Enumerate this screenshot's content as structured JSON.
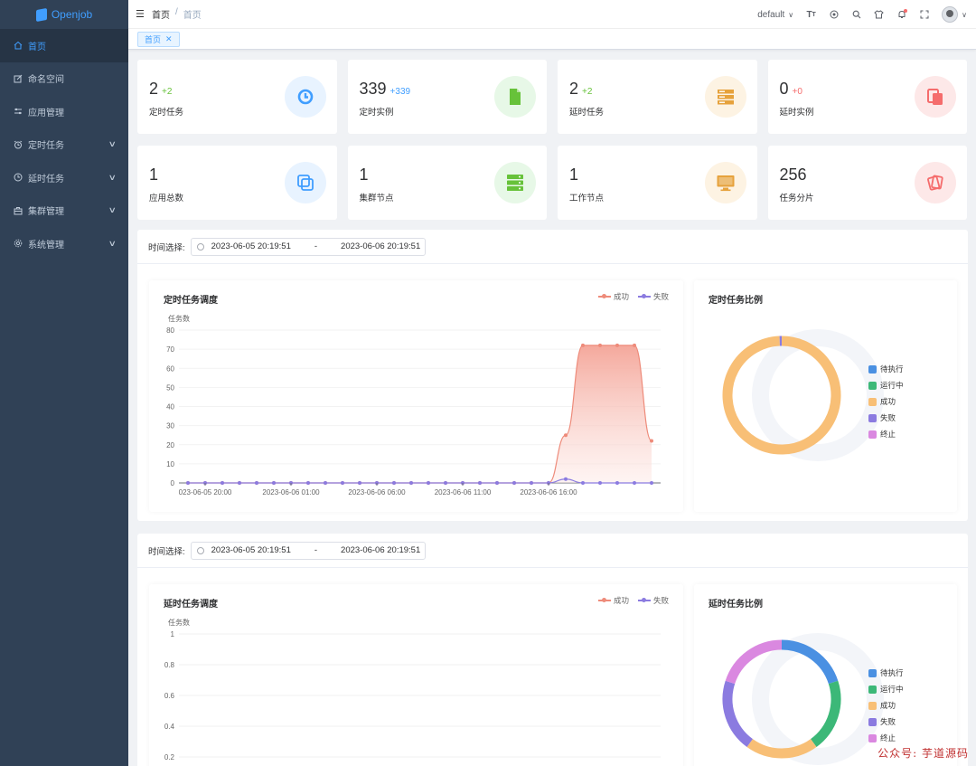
{
  "app": {
    "title": "Openjob"
  },
  "sidebar": {
    "items": [
      {
        "label": "首页",
        "icon": "home-icon",
        "active": true,
        "expandable": false
      },
      {
        "label": "命名空间",
        "icon": "edit-icon",
        "active": false,
        "expandable": false
      },
      {
        "label": "应用管理",
        "icon": "sliders-icon",
        "active": false,
        "expandable": false
      },
      {
        "label": "定时任务",
        "icon": "alarm-icon",
        "active": false,
        "expandable": true
      },
      {
        "label": "延时任务",
        "icon": "clock-icon",
        "active": false,
        "expandable": true
      },
      {
        "label": "集群管理",
        "icon": "briefcase-icon",
        "active": false,
        "expandable": true
      },
      {
        "label": "系统管理",
        "icon": "gear-icon",
        "active": false,
        "expandable": true
      }
    ]
  },
  "navbar": {
    "breadcrumb": [
      "首页",
      "首页"
    ],
    "namespace": "default",
    "icons": [
      "font-size-icon",
      "github-icon",
      "search-icon",
      "theme-icon",
      "bell-icon",
      "fullscreen-icon"
    ]
  },
  "tags": [
    {
      "label": "首页"
    }
  ],
  "stats": [
    {
      "value": "2",
      "delta": "+2",
      "label": "定时任务",
      "icon": "history-icon",
      "color": "#409eff",
      "bg": "#e8f3ff",
      "delta_color": "#67c23a"
    },
    {
      "value": "339",
      "delta": "+339",
      "label": "定时实例",
      "icon": "document-icon",
      "color": "#67c23a",
      "bg": "#e7f8e7",
      "delta_color": "#409eff"
    },
    {
      "value": "2",
      "delta": "+2",
      "label": "延时任务",
      "icon": "server-icon",
      "color": "#e6a23c",
      "bg": "#fdf3e3",
      "delta_color": "#67c23a"
    },
    {
      "value": "0",
      "delta": "+0",
      "label": "延时实例",
      "icon": "copy-doc-icon",
      "color": "#f56c6c",
      "bg": "#fde8e8",
      "delta_color": "#f56c6c"
    },
    {
      "value": "1",
      "delta": "",
      "label": "应用总数",
      "icon": "copy-icon",
      "color": "#409eff",
      "bg": "#e8f3ff",
      "delta_color": ""
    },
    {
      "value": "1",
      "delta": "",
      "label": "集群节点",
      "icon": "server-stack-icon",
      "color": "#67c23a",
      "bg": "#e7f8e7",
      "delta_color": ""
    },
    {
      "value": "1",
      "delta": "",
      "label": "工作节点",
      "icon": "monitor-icon",
      "color": "#e6a23c",
      "bg": "#fdf3e3",
      "delta_color": ""
    },
    {
      "value": "256",
      "delta": "",
      "label": "任务分片",
      "icon": "files-icon",
      "color": "#f56c6c",
      "bg": "#fde8e8",
      "delta_color": ""
    }
  ],
  "sections": [
    {
      "time_label": "时间选择:",
      "range_start": "2023-06-05 20:19:51",
      "range_sep": "-",
      "range_end": "2023-06-06 20:19:51",
      "line_title": "定时任务调度",
      "pie_title": "定时任务比例"
    },
    {
      "time_label": "时间选择:",
      "range_start": "2023-06-05 20:19:51",
      "range_sep": "-",
      "range_end": "2023-06-06 20:19:51",
      "line_title": "延时任务调度",
      "pie_title": "延时任务比例"
    }
  ],
  "pie_legend": [
    {
      "label": "待执行",
      "color": "#4a90e2"
    },
    {
      "label": "运行中",
      "color": "#3cb878"
    },
    {
      "label": "成功",
      "color": "#f8bf76"
    },
    {
      "label": "失败",
      "color": "#8b7be0"
    },
    {
      "label": "终止",
      "color": "#da88e0"
    }
  ],
  "watermark": "公众号: 芋道源码",
  "chart_data": [
    {
      "type": "area",
      "title": "定时任务调度",
      "ylabel": "任务数",
      "ylim": [
        0,
        80
      ],
      "yticks": [
        0,
        10,
        20,
        30,
        40,
        50,
        60,
        70,
        80
      ],
      "xtick_labels": [
        "023-06-05 20:00",
        "2023-06-06 01:00",
        "2023-06-06 06:00",
        "2023-06-06 11:00",
        "2023-06-06 16:00"
      ],
      "xtick_index": [
        1,
        6,
        11,
        16,
        21
      ],
      "legend_position": "top-right",
      "series": [
        {
          "name": "成功",
          "color": "#ee8b7a",
          "values": [
            0,
            0,
            0,
            0,
            0,
            0,
            0,
            0,
            0,
            0,
            0,
            0,
            0,
            0,
            0,
            0,
            0,
            0,
            0,
            0,
            0,
            0,
            25,
            72,
            72,
            72,
            72,
            22
          ]
        },
        {
          "name": "失败",
          "color": "#8b7be0",
          "values": [
            0,
            0,
            0,
            0,
            0,
            0,
            0,
            0,
            0,
            0,
            0,
            0,
            0,
            0,
            0,
            0,
            0,
            0,
            0,
            0,
            0,
            0,
            2,
            0,
            0,
            0,
            0,
            0
          ]
        }
      ]
    },
    {
      "type": "pie",
      "title": "定时任务比例",
      "legend_position": "right",
      "categories": [
        "待执行",
        "运行中",
        "成功",
        "失败",
        "终止"
      ],
      "values": [
        0,
        0,
        337,
        2,
        0
      ]
    },
    {
      "type": "line",
      "title": "延时任务调度",
      "ylabel": "任务数",
      "ylim": [
        0,
        1
      ],
      "yticks": [
        0.2,
        0.4,
        0.6,
        0.8,
        1
      ],
      "legend_position": "top-right",
      "series": [
        {
          "name": "成功",
          "color": "#ee8b7a",
          "values": []
        },
        {
          "name": "失败",
          "color": "#8b7be0",
          "values": []
        }
      ]
    },
    {
      "type": "pie",
      "title": "延时任务比例",
      "legend_position": "right",
      "categories": [
        "待执行",
        "运行中",
        "成功",
        "失败",
        "终止"
      ],
      "values": [
        2,
        2,
        2,
        2,
        2
      ]
    }
  ]
}
